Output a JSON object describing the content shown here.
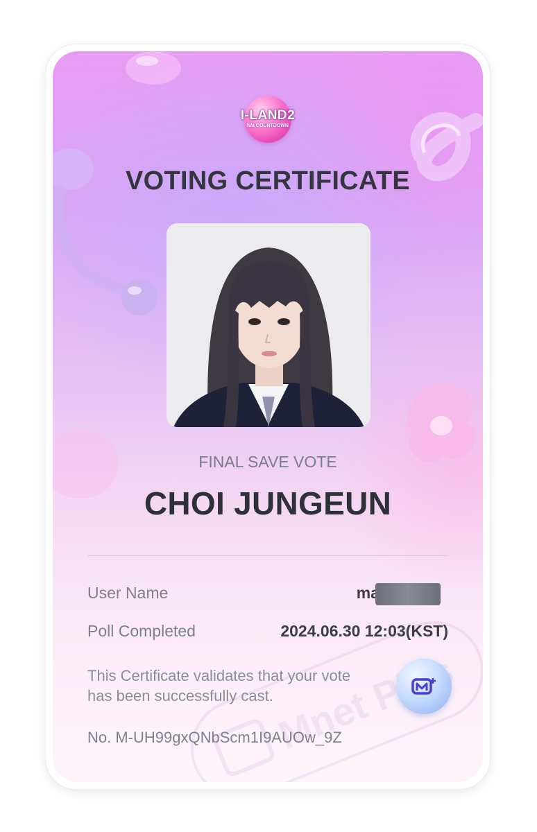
{
  "logo": {
    "name": "I-LAND2",
    "subtitle": "N/a COUNTDOWN"
  },
  "title": "VOTING CERTIFICATE",
  "vote_type": "FINAL SAVE VOTE",
  "candidate_name": "CHOI JUNGEUN",
  "details": {
    "user_name_label": "User Name",
    "user_name_value": "mar",
    "poll_completed_label": "Poll Completed",
    "poll_completed_value": "2024.06.30 12:03(KST)"
  },
  "note": "This Certificate validates that your vote has been successfully cast.",
  "certificate_number": "No. M-UH99gxQNbScm1I9AUOw_9Z",
  "badge_icon": "mnet-plus-icon",
  "watermark_text": "Mnet Plus",
  "colors": {
    "title": "#33363f",
    "card_gradient_top": "#e79cf3",
    "card_gradient_bottom": "#fdf5fb"
  }
}
